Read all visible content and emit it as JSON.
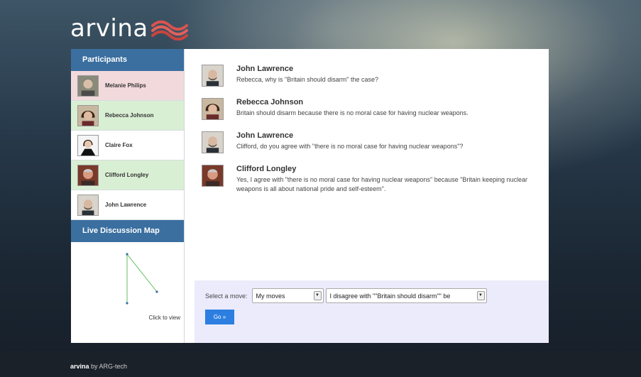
{
  "brand": {
    "name": "arvina"
  },
  "sidebar": {
    "participants_header": "Participants",
    "participants": [
      {
        "name": "Melanie Philips",
        "bg": "#f2d9dc",
        "avatar_icon": "avatar-melanie-philips"
      },
      {
        "name": "Rebecca Johnson",
        "bg": "#d9efd4",
        "avatar_icon": "avatar-rebecca-johnson"
      },
      {
        "name": "Claire Fox",
        "bg": "#ffffff",
        "avatar_icon": "avatar-claire-fox"
      },
      {
        "name": "Clifford Longley",
        "bg": "#d9efd4",
        "avatar_icon": "avatar-clifford-longley"
      },
      {
        "name": "John Lawrence",
        "bg": "#ffffff",
        "avatar_icon": "avatar-john-lawrence"
      }
    ],
    "map_header": "Live Discussion Map",
    "map_link": "Click to view"
  },
  "messages": [
    {
      "speaker": "John Lawrence",
      "text": "Rebecca, why is \"Britain should disarm\" the case?"
    },
    {
      "speaker": "Rebecca Johnson",
      "text": "Britain should disarm because there is no moral case for having nuclear weapons."
    },
    {
      "speaker": "John Lawrence",
      "text": "Clifford, do you agree with \"there is no moral case for having nuclear weapons\"?"
    },
    {
      "speaker": "Clifford Longley",
      "text": "Yes, I agree with \"there is no moral case for having nuclear weapons\" because \"Britain keeping nuclear weapons is all about national pride and self-esteem\"."
    }
  ],
  "move_panel": {
    "label": "Select a move:",
    "move_type": "My moves",
    "move_option": "I disagree with \"\"Britain should disarm\"\" be",
    "go_label": "Go »"
  },
  "footer": {
    "brand": "arvina",
    "by": " by ",
    "org": "ARG-tech"
  },
  "colors": {
    "accent_header": "#3a6f9f",
    "go_button": "#2c7fe0",
    "panel_bg": "#ebebfc",
    "map_line": "#5cc25c",
    "map_node": "#3a6f9f"
  }
}
